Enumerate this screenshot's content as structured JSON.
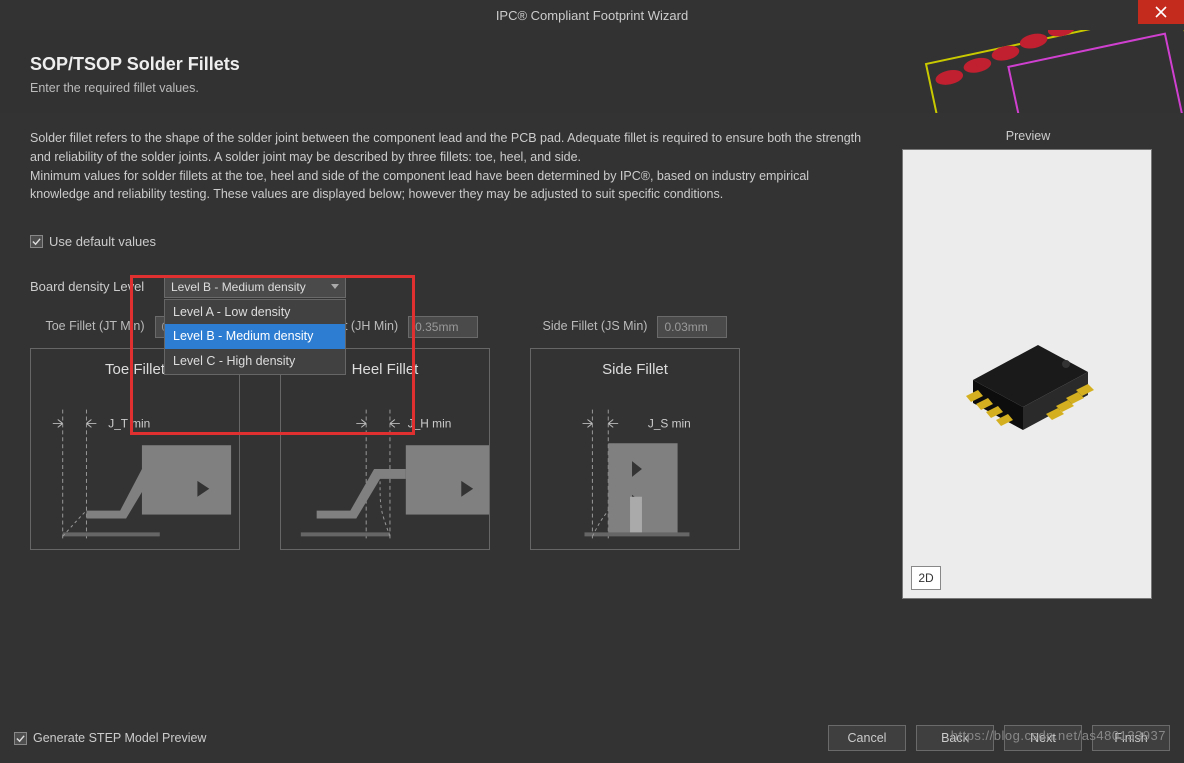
{
  "window": {
    "title": "IPC® Compliant Footprint Wizard"
  },
  "header": {
    "title": "SOP/TSOP Solder Fillets",
    "subtitle": "Enter the required fillet values."
  },
  "description": {
    "line1": "Solder fillet refers to the shape of the solder joint between the component lead and the PCB pad. Adequate fillet is required to ensure both the strength and reliability of the solder joints. A solder joint may be described by three fillets: toe, heel, and side.",
    "line2": "Minimum values for solder fillets at the toe, heel and side of the component lead have been determined by IPC®, based on industry empirical knowledge and reliability testing. These values are displayed below; however they may be adjusted to suit specific conditions."
  },
  "options": {
    "use_default_label": "Use default values",
    "use_default_checked": true,
    "density_label": "Board density Level",
    "density_selected": "Level B - Medium density",
    "density_options": [
      "Level A - Low density",
      "Level B - Medium density",
      "Level C - High density"
    ]
  },
  "fillets": {
    "toe": {
      "input_label": "Toe Fillet (JT Min)",
      "value": "0.35mm",
      "diagram_title": "Toe Fillet",
      "dim_label": "J_T min"
    },
    "heel": {
      "input_label": "Heel Fillet (JH Min)",
      "value": "0.35mm",
      "diagram_title": "Heel Fillet",
      "dim_label": "J_H min"
    },
    "side": {
      "input_label": "Side Fillet (JS Min)",
      "value": "0.03mm",
      "diagram_title": "Side Fillet",
      "dim_label": "J_S min"
    }
  },
  "preview": {
    "label": "Preview",
    "mode_button": "2D"
  },
  "footer": {
    "generate_step_label": "Generate STEP Model Preview",
    "generate_step_checked": true,
    "cancel": "Cancel",
    "back": "Back",
    "next": "Next",
    "finish": "Finish"
  },
  "watermark": "https://blog.csdn.net/as480133937"
}
